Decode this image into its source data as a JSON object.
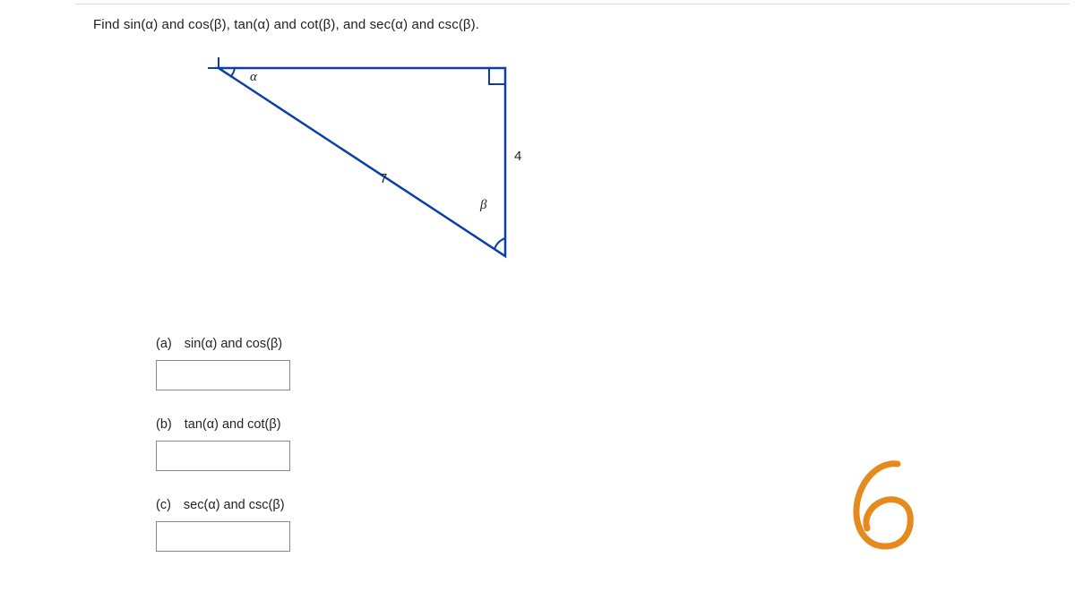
{
  "prompt": "Find sin(α) and cos(β), tan(α) and cot(β), and sec(α) and csc(β).",
  "figure": {
    "alpha_label": "α",
    "beta_label": "β",
    "hypotenuse_label": "7",
    "side_label": "4"
  },
  "parts": {
    "a": {
      "letter": "(a)",
      "text": "sin(α) and cos(β)"
    },
    "b": {
      "letter": "(b)",
      "text": "tan(α) and cot(β)"
    },
    "c": {
      "letter": "(c)",
      "text": "sec(α) and csc(β)"
    }
  },
  "handwritten_mark": "6"
}
